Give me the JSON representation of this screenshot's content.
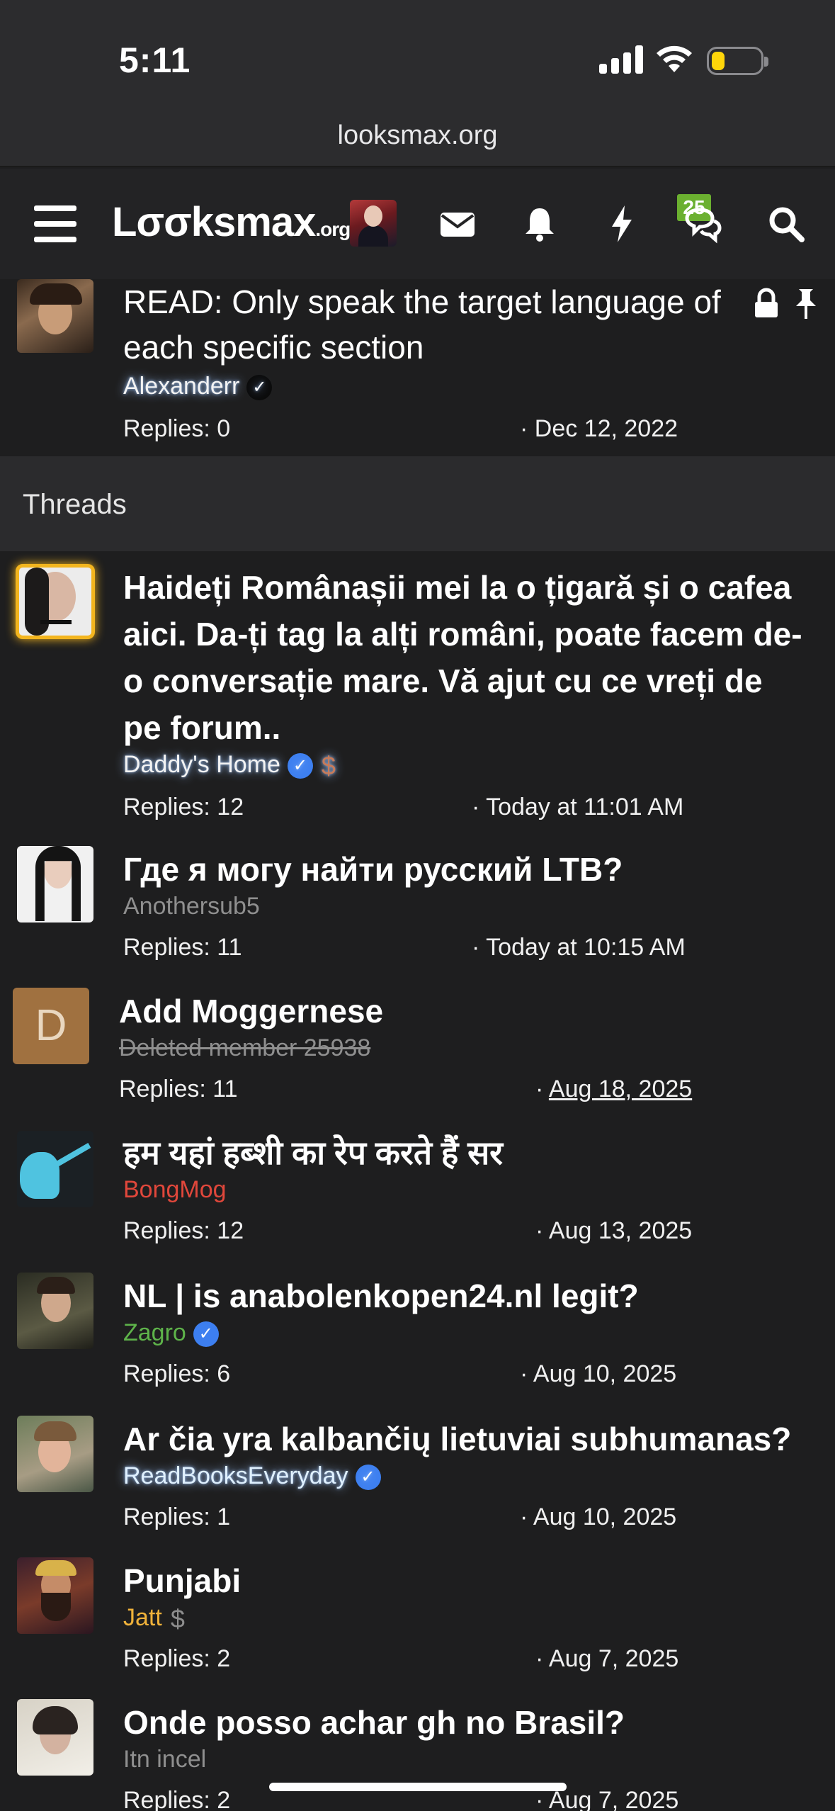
{
  "status_bar": {
    "time": "5:11"
  },
  "browser": {
    "url": "looksmax.org"
  },
  "nav": {
    "logo_main": "Lσσksmax",
    "logo_suffix": ".org",
    "alerts_badge": "25"
  },
  "sticky_thread": {
    "title": "READ: Only speak the target language of each specific section",
    "author": "Alexanderr",
    "replies": "Replies: 0",
    "date": "· Dec 12, 2022"
  },
  "section": {
    "label": "Threads"
  },
  "threads": [
    {
      "title": "Haideți Românașii mei la o țigară și o cafea aici. Da-ți tag la alți români, poate facem de-o conversație mare. Vă ajut cu ce vreți de pe forum..",
      "author": "Daddy's Home",
      "replies": "Replies: 12",
      "date": "· Today at 11:01 AM"
    },
    {
      "title": "Где я могу найти русский LTB?",
      "author": "Anothersub5",
      "replies": "Replies: 11",
      "date": "· Today at 10:15 AM"
    },
    {
      "title": "Add Moggernese",
      "author": "Deleted member 25938",
      "avatar_letter": "D",
      "replies": "Replies: 11",
      "date_prefix": "·",
      "date": "Aug 18, 2025"
    },
    {
      "title": "हम यहां हब्शी का रेप करते हैं सर",
      "author": "BongMog",
      "replies": "Replies: 12",
      "date": "· Aug 13, 2025"
    },
    {
      "title": "NL | is anabolenkopen24.nl legit?",
      "author": "Zagro",
      "replies": "Replies: 6",
      "date": "· Aug 10, 2025"
    },
    {
      "title": "Ar čia yra kalbančių lietuviai subhumanas?",
      "author": "ReadBooksEveryday",
      "replies": "Replies: 1",
      "date": "· Aug 10, 2025"
    },
    {
      "title": "Punjabi",
      "author": "Jatt",
      "replies": "Replies: 2",
      "date": "· Aug 7, 2025"
    },
    {
      "title": "Onde posso achar gh no Brasil?",
      "author": "Itn incel",
      "replies": "Replies: 2",
      "date": "· Aug 7, 2025"
    }
  ],
  "colors": {
    "background": "#1e1e1f",
    "section_header": "#2b2b2d",
    "badge_green": "#6bb030",
    "author_red": "#e0473b",
    "author_green": "#5eb34a",
    "author_blue": "#3d7ff0",
    "author_gold": "#f0b23a"
  },
  "icons": [
    "hamburger-icon",
    "mail-icon",
    "bell-icon",
    "lightning-icon",
    "chat-icon",
    "search-icon",
    "lock-icon",
    "pin-icon",
    "verified-icon",
    "dollar-icon"
  ]
}
